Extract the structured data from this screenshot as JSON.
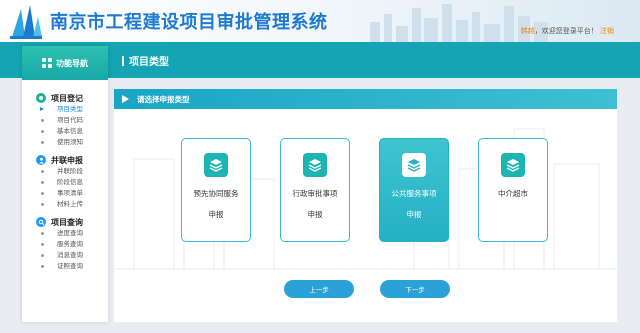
{
  "header": {
    "title": "南京市工程建设项目审批管理系统",
    "user_name": "韩越",
    "welcome_text": "，欢迎您登录平台！",
    "logout_label": "注销"
  },
  "sidebar": {
    "title": "功能导航",
    "groups": [
      {
        "title": "项目登记",
        "icon": "circle-dot-icon",
        "color": "#19b394",
        "items": [
          {
            "label": "项目类型",
            "active": true
          },
          {
            "label": "项目代码"
          },
          {
            "label": "基本信息"
          },
          {
            "label": "使用须知"
          }
        ]
      },
      {
        "title": "并联申报",
        "icon": "person-icon",
        "color": "#2196f3",
        "items": [
          {
            "label": "并联阶段"
          },
          {
            "label": "阶段信息"
          },
          {
            "label": "事项清单"
          },
          {
            "label": "材料上传"
          }
        ]
      },
      {
        "title": "项目查询",
        "icon": "search-icon",
        "color": "#2196f3",
        "items": [
          {
            "label": "进度查询"
          },
          {
            "label": "服务查询"
          },
          {
            "label": "消息查询"
          },
          {
            "label": "证照查询"
          }
        ]
      }
    ]
  },
  "page": {
    "title": "项目类型"
  },
  "panel": {
    "heading": "请选择申报类型",
    "cards": [
      {
        "line1": "预先协同服务",
        "line2": "申报",
        "selected": false
      },
      {
        "line1": "行政审批事项",
        "line2": "申报",
        "selected": false
      },
      {
        "line1": "公共服务事项",
        "line2": "申报",
        "selected": true
      },
      {
        "line1": "中介超市",
        "line2": "",
        "selected": false
      }
    ],
    "prev_label": "上一步",
    "next_label": "下一步"
  },
  "colors": {
    "accent": "#14a4b3",
    "title_blue": "#1c7bd0",
    "button_blue": "#2aa2d8",
    "highlight_orange": "#e58a00"
  }
}
